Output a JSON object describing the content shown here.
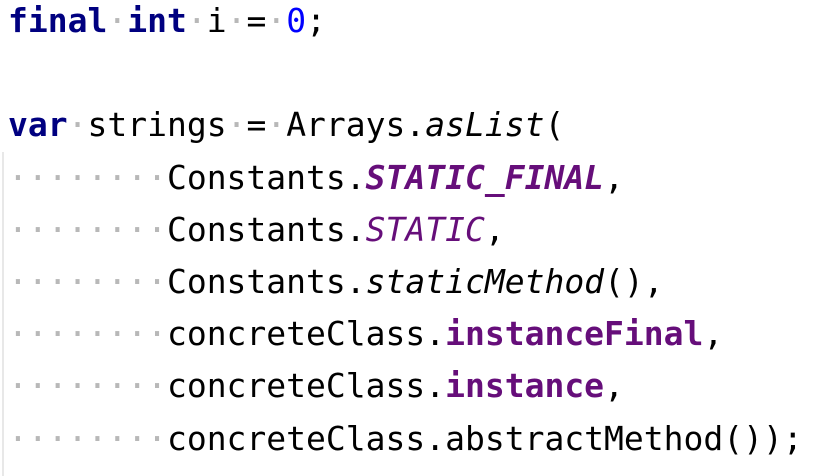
{
  "editor": {
    "colors": {
      "keyword": "#000080",
      "number": "#0000ff",
      "static_field": "#660e7a",
      "whitespace_dot": "#b8b8b8"
    },
    "lines": [
      [
        {
          "t": "final",
          "c": "kw"
        },
        {
          "t": "·",
          "c": "ws"
        },
        {
          "t": "int",
          "c": "kw"
        },
        {
          "t": "·",
          "c": "ws"
        },
        {
          "t": "i"
        },
        {
          "t": "·",
          "c": "ws"
        },
        {
          "t": "="
        },
        {
          "t": "·",
          "c": "ws"
        },
        {
          "t": "0",
          "c": "num"
        },
        {
          "t": ";"
        }
      ],
      [],
      [
        {
          "t": "var",
          "c": "kw"
        },
        {
          "t": "·",
          "c": "ws"
        },
        {
          "t": "strings"
        },
        {
          "t": "·",
          "c": "ws"
        },
        {
          "t": "="
        },
        {
          "t": "·",
          "c": "ws"
        },
        {
          "t": "Arrays."
        },
        {
          "t": "asList",
          "c": "sm"
        },
        {
          "t": "("
        }
      ],
      [
        {
          "t": "········",
          "c": "ws"
        },
        {
          "t": "Constants."
        },
        {
          "t": "STATIC_FINAL",
          "c": "sf"
        },
        {
          "t": ","
        }
      ],
      [
        {
          "t": "········",
          "c": "ws"
        },
        {
          "t": "Constants."
        },
        {
          "t": "STATIC",
          "c": "s"
        },
        {
          "t": ","
        }
      ],
      [
        {
          "t": "········",
          "c": "ws"
        },
        {
          "t": "Constants."
        },
        {
          "t": "staticMethod",
          "c": "sm"
        },
        {
          "t": "(),"
        }
      ],
      [
        {
          "t": "········",
          "c": "ws"
        },
        {
          "t": "concreteClass."
        },
        {
          "t": "instanceFinal",
          "c": "fld"
        },
        {
          "t": ","
        }
      ],
      [
        {
          "t": "········",
          "c": "ws"
        },
        {
          "t": "concreteClass."
        },
        {
          "t": "instance",
          "c": "fld"
        },
        {
          "t": ","
        }
      ],
      [
        {
          "t": "········",
          "c": "ws"
        },
        {
          "t": "concreteClass.abstractMethod());"
        }
      ]
    ]
  }
}
